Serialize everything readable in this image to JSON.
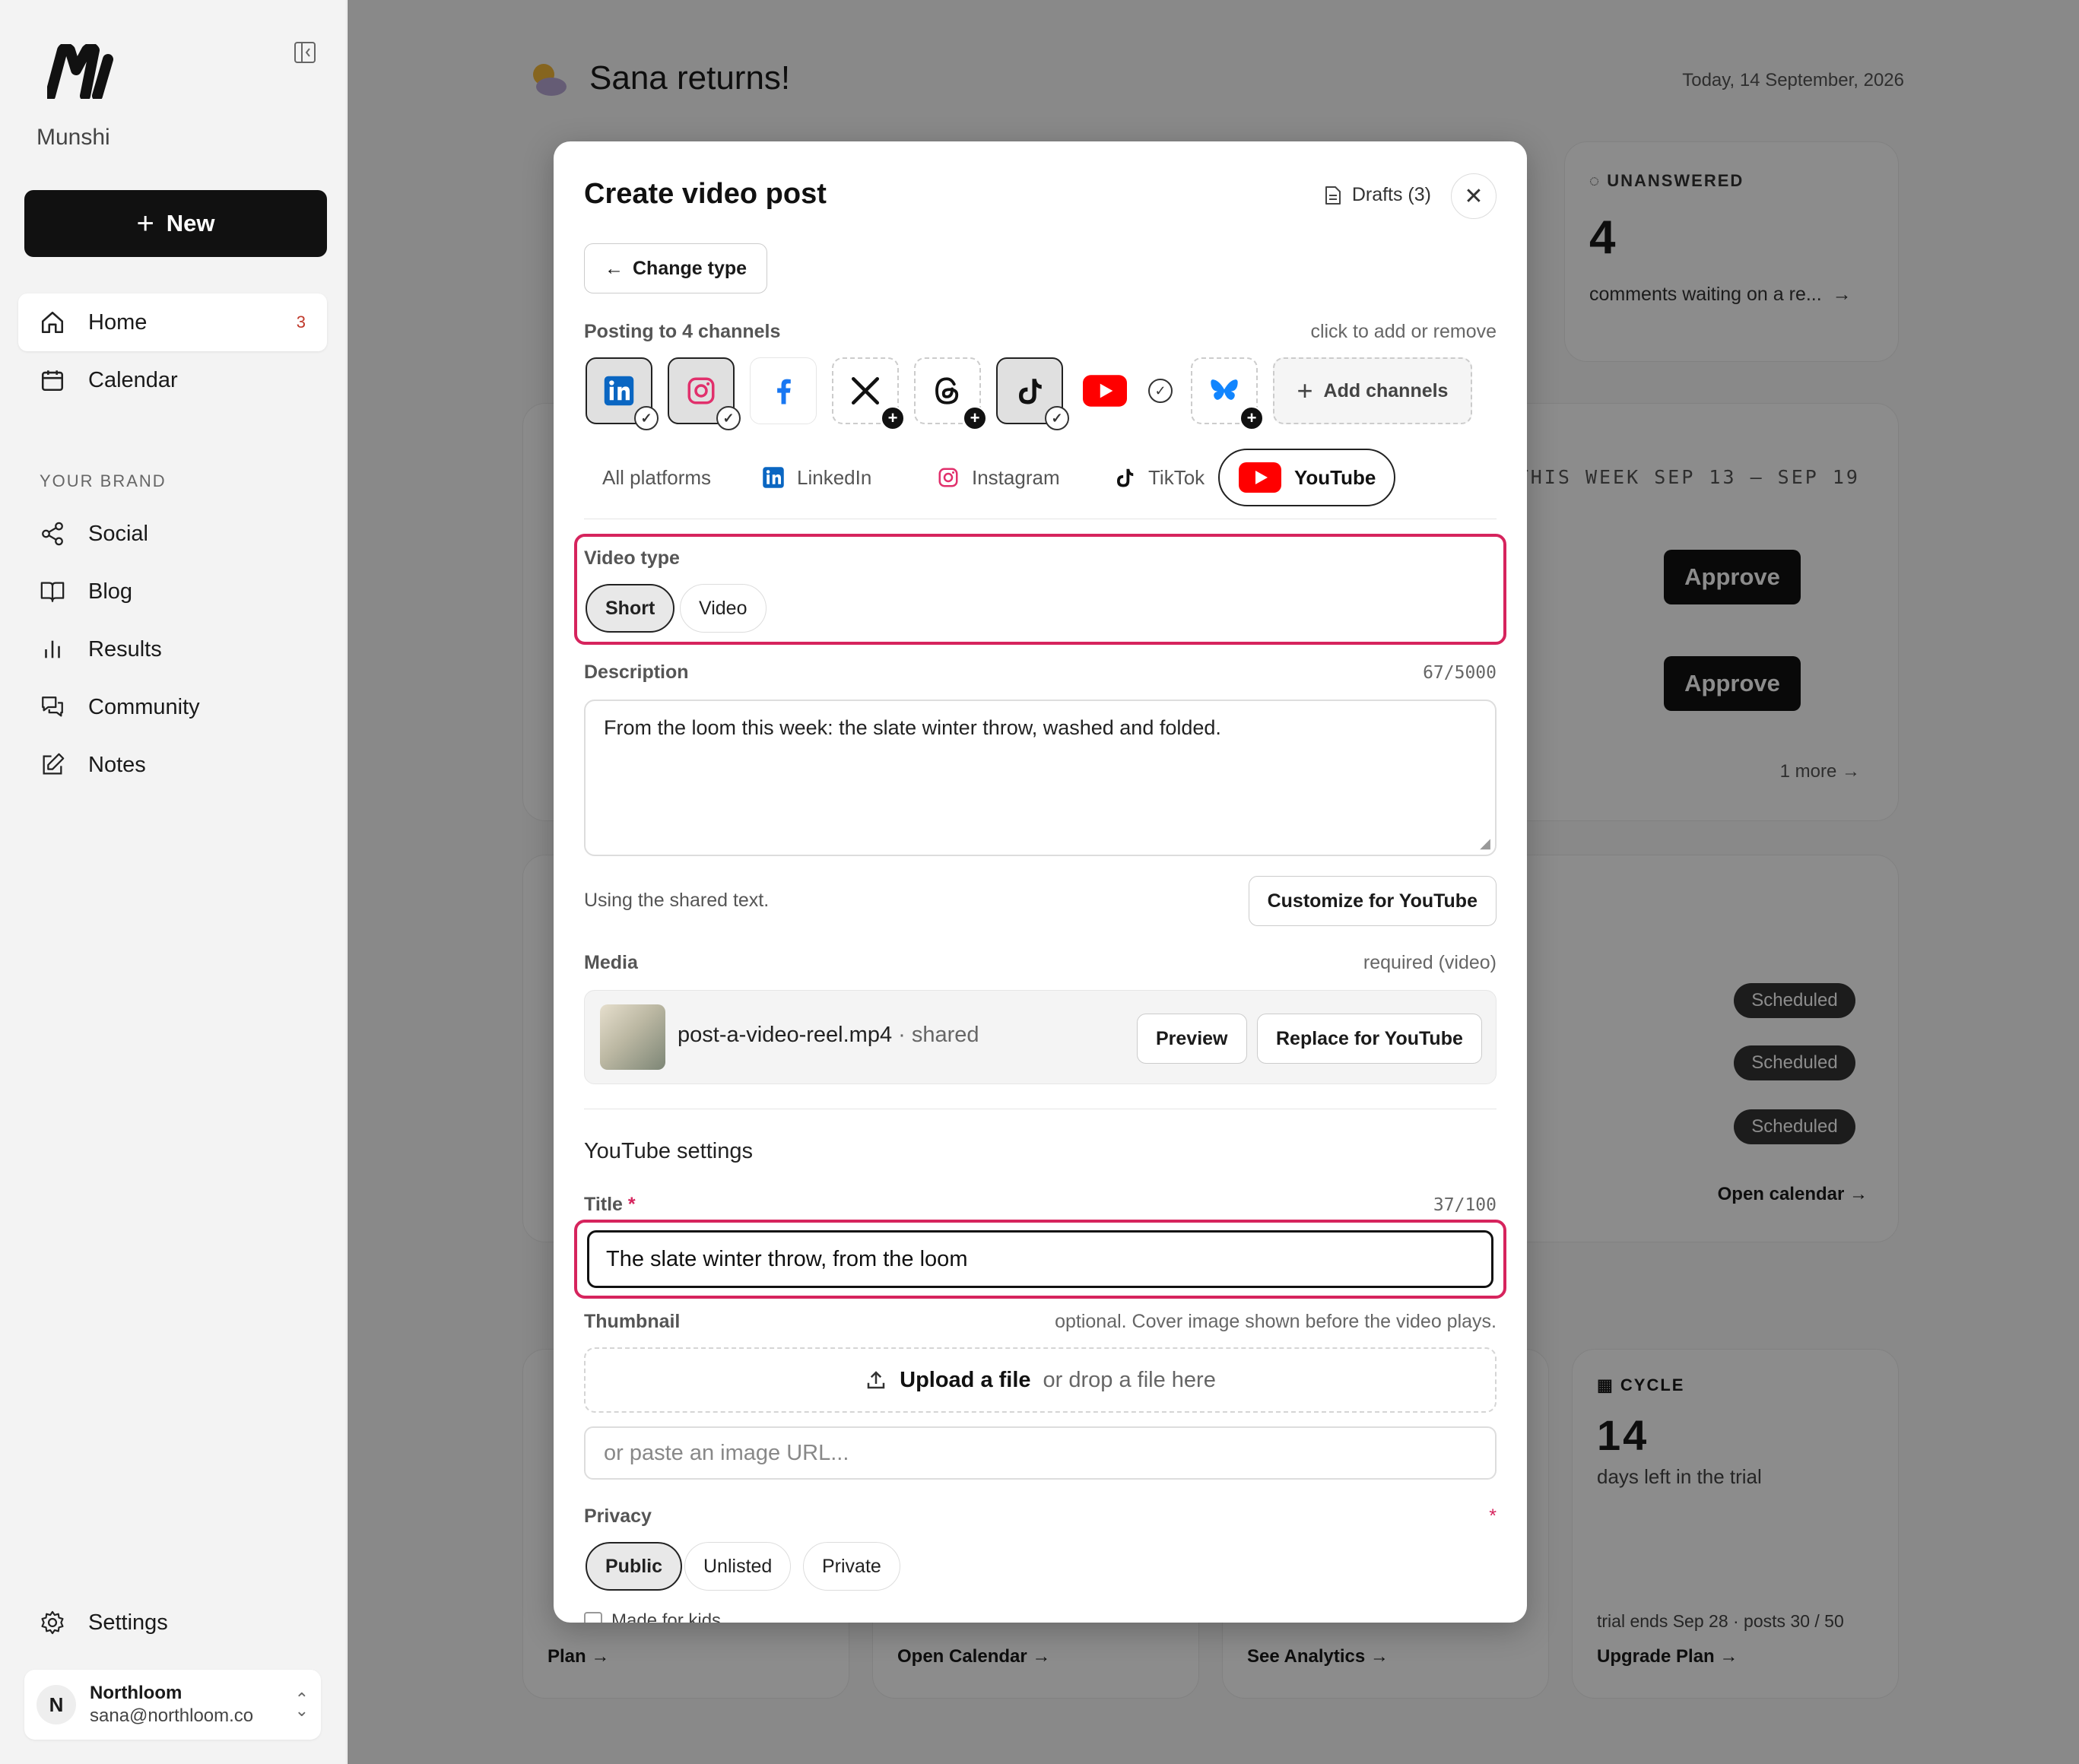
{
  "sidebar": {
    "brand": "Munshi",
    "new_label": "New",
    "nav": [
      {
        "label": "Home",
        "count": "3"
      },
      {
        "label": "Calendar"
      }
    ],
    "section_label": "YOUR BRAND",
    "brand_nav": [
      {
        "label": "Social"
      },
      {
        "label": "Blog"
      },
      {
        "label": "Results"
      },
      {
        "label": "Community"
      },
      {
        "label": "Notes"
      }
    ],
    "settings_label": "Settings",
    "account": {
      "initial": "N",
      "name": "Northloom",
      "email": "sana@northloom.co"
    }
  },
  "background": {
    "greeting": "Sana returns!",
    "date": "Today, 14 September, 2026",
    "unanswered": {
      "label": "UNANSWERED",
      "count": "4",
      "text": "comments waiting on a re..."
    },
    "week": {
      "label": "THIS WEEK   SEP 13 – SEP 19",
      "approve": "Approve",
      "more": "1 more"
    },
    "scheduled": {
      "pill": "Scheduled",
      "link": "Open calendar →"
    },
    "stats": [
      {
        "link": "Plan →"
      },
      {
        "link": "Open Calendar →"
      },
      {
        "link": "See Analytics →"
      }
    ],
    "cycle": {
      "label": "CYCLE",
      "count": "14",
      "text": "days left in the trial",
      "foot": "trial ends Sep 28 · posts 30 / 50",
      "link": "Upgrade Plan →"
    }
  },
  "modal": {
    "title": "Create video post",
    "drafts": "Drafts (3)",
    "change_type": "Change type",
    "posting_label": "Posting to 4 channels",
    "posting_hint": "click to add or remove",
    "add_channels": "Add channels",
    "platform_tabs": [
      "All platforms",
      "LinkedIn",
      "Instagram",
      "TikTok",
      "YouTube"
    ],
    "video_type": {
      "label": "Video type",
      "options": [
        "Short",
        "Video"
      ],
      "selected": "Short"
    },
    "description": {
      "label": "Description",
      "counter": "67/5000",
      "value": "From the loom this week: the slate winter throw, washed and folded."
    },
    "shared_note": "Using the shared text.",
    "customize": "Customize for YouTube",
    "media": {
      "label": "Media",
      "hint": "required (video)",
      "filename": "post-a-video-reel.mp4",
      "shared": " · shared",
      "preview": "Preview",
      "replace": "Replace for YouTube"
    },
    "yt_settings": "YouTube settings",
    "title_field": {
      "label": "Title",
      "required": "*",
      "counter": "37/100",
      "value": "The slate winter throw, from the loom"
    },
    "thumbnail": {
      "label": "Thumbnail",
      "hint": "optional. Cover image shown before the video plays.",
      "upload_bold": "Upload a file",
      "upload_rest": "or drop a file here",
      "url_placeholder": "or paste an image URL..."
    },
    "privacy": {
      "label": "Privacy",
      "required": "*",
      "options": [
        "Public",
        "Unlisted",
        "Private"
      ],
      "selected": "Public"
    },
    "kids_label": "Made for kids"
  },
  "colors": {
    "accent": "#d6245d",
    "dark": "#111111",
    "youtube": "#ff0000",
    "linkedin": "#0a66c2",
    "instagram": "#e1306c",
    "facebook": "#1877f2",
    "bluesky": "#1185fe"
  }
}
